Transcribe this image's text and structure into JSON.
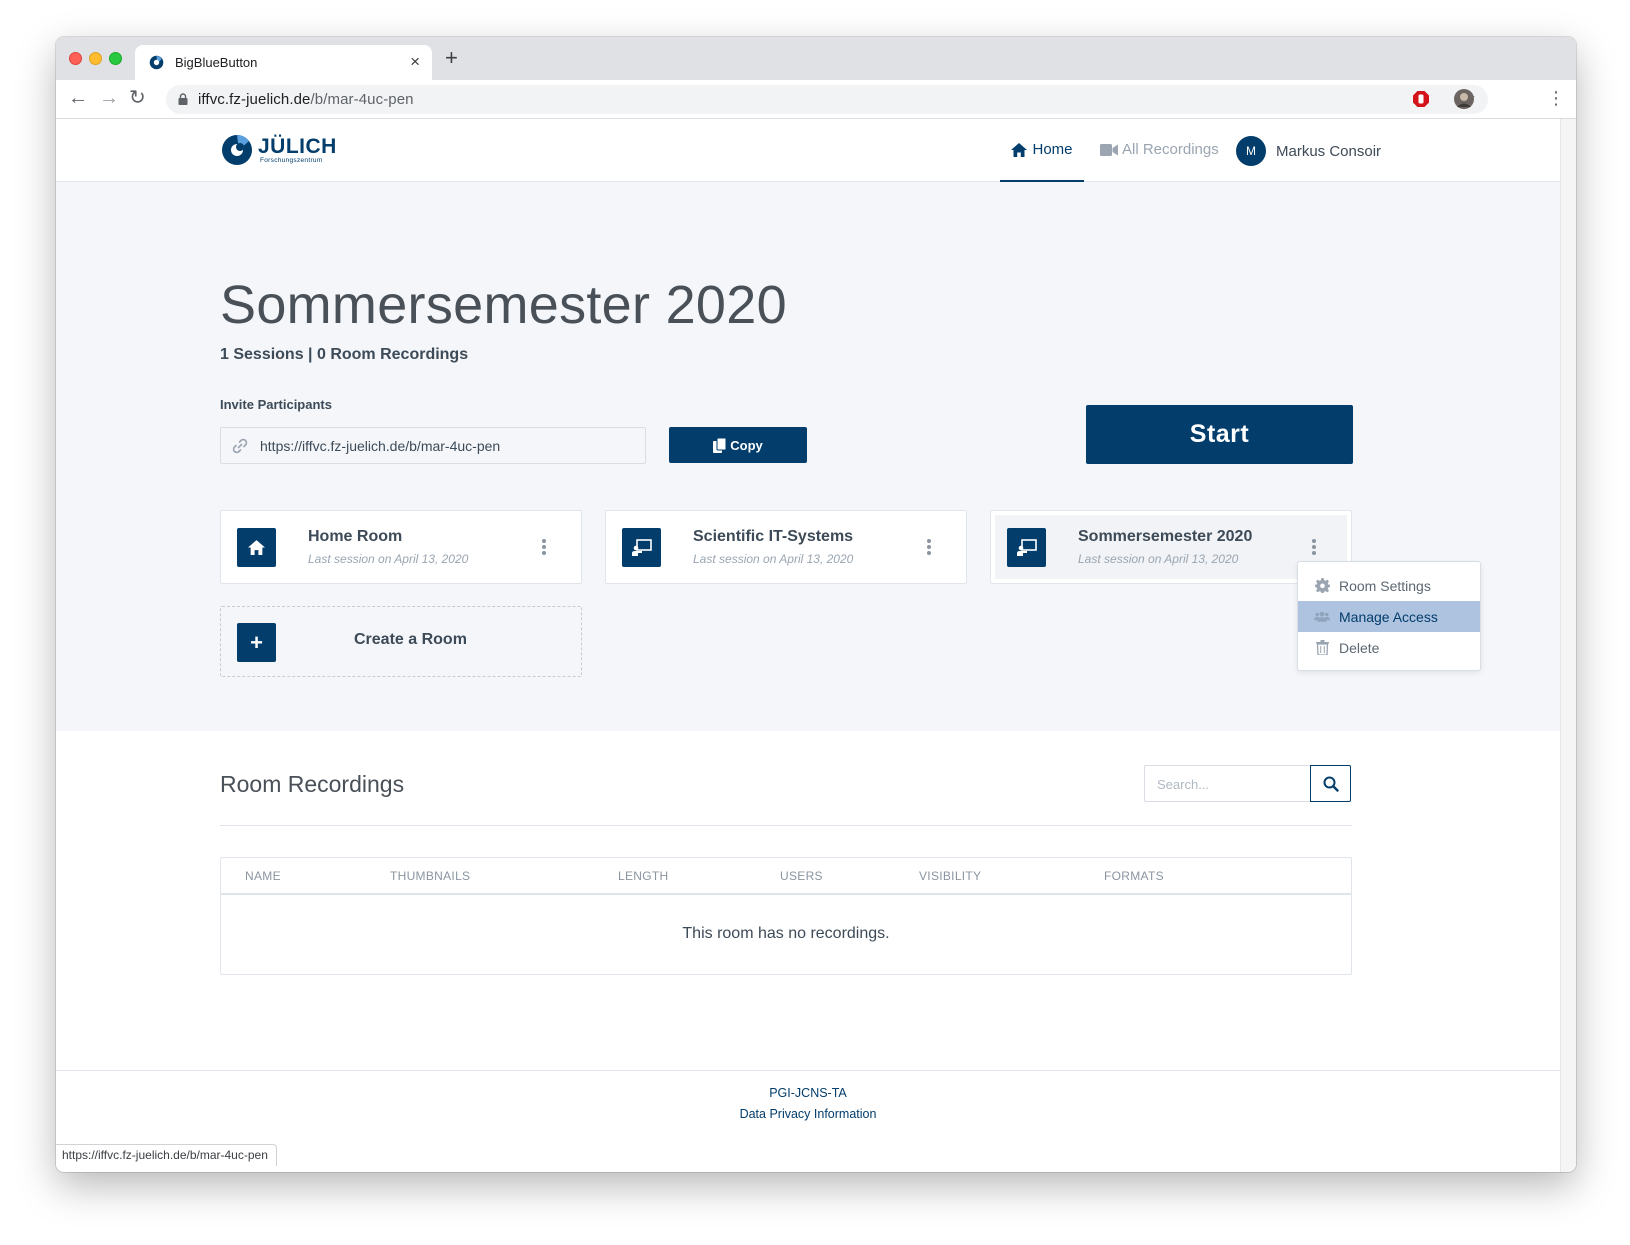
{
  "browser": {
    "tab_title": "BigBlueButton",
    "tab_close": "×",
    "new_tab": "+",
    "url_host": "iffvc.fz-juelich.de",
    "url_path": "/b/mar-4uc-pen",
    "back": "←",
    "forward": "→",
    "reload": "↻",
    "star": "☆",
    "menu": "⋮",
    "status_url": "https://iffvc.fz-juelich.de/b/mar-4uc-pen"
  },
  "header": {
    "logo_name": "JÜLICH",
    "logo_sub": "Forschungszentrum",
    "nav_home": "Home",
    "nav_recordings": "All Recordings",
    "avatar_initial": "M",
    "user_name": "Markus Consoir"
  },
  "room": {
    "title": "Sommersemester 2020",
    "stats": "1 Sessions | 0 Room Recordings",
    "invite_label": "Invite Participants",
    "invite_url": "https://iffvc.fz-juelich.de/b/mar-4uc-pen",
    "copy_label": "Copy",
    "start_label": "Start"
  },
  "rooms": [
    {
      "name": "Home Room",
      "session": "Last session on April 13, 2020",
      "icon": "home-icon"
    },
    {
      "name": "Scientific IT-Systems",
      "session": "Last session on April 13, 2020",
      "icon": "presentation-icon"
    },
    {
      "name": "Sommersemester 2020",
      "session": "Last session on April 13, 2020",
      "icon": "presentation-icon"
    }
  ],
  "create_room": {
    "icon": "+",
    "label": "Create a Room"
  },
  "room_menu": [
    {
      "label": "Room Settings",
      "icon": "gear-icon"
    },
    {
      "label": "Manage Access",
      "icon": "users-icon"
    },
    {
      "label": "Delete",
      "icon": "trash-icon"
    }
  ],
  "recordings": {
    "title": "Room Recordings",
    "search_placeholder": "Search...",
    "columns": [
      "NAME",
      "THUMBNAILS",
      "LENGTH",
      "USERS",
      "VISIBILITY",
      "FORMATS"
    ],
    "empty_text": "This room has no recordings."
  },
  "footer": {
    "link1": "PGI-JCNS-TA",
    "link2": "Data Privacy Information"
  },
  "colors": {
    "brand": "#023d6b",
    "page_bg": "#f4f6fa",
    "menu_highlight": "#aec3e0"
  }
}
